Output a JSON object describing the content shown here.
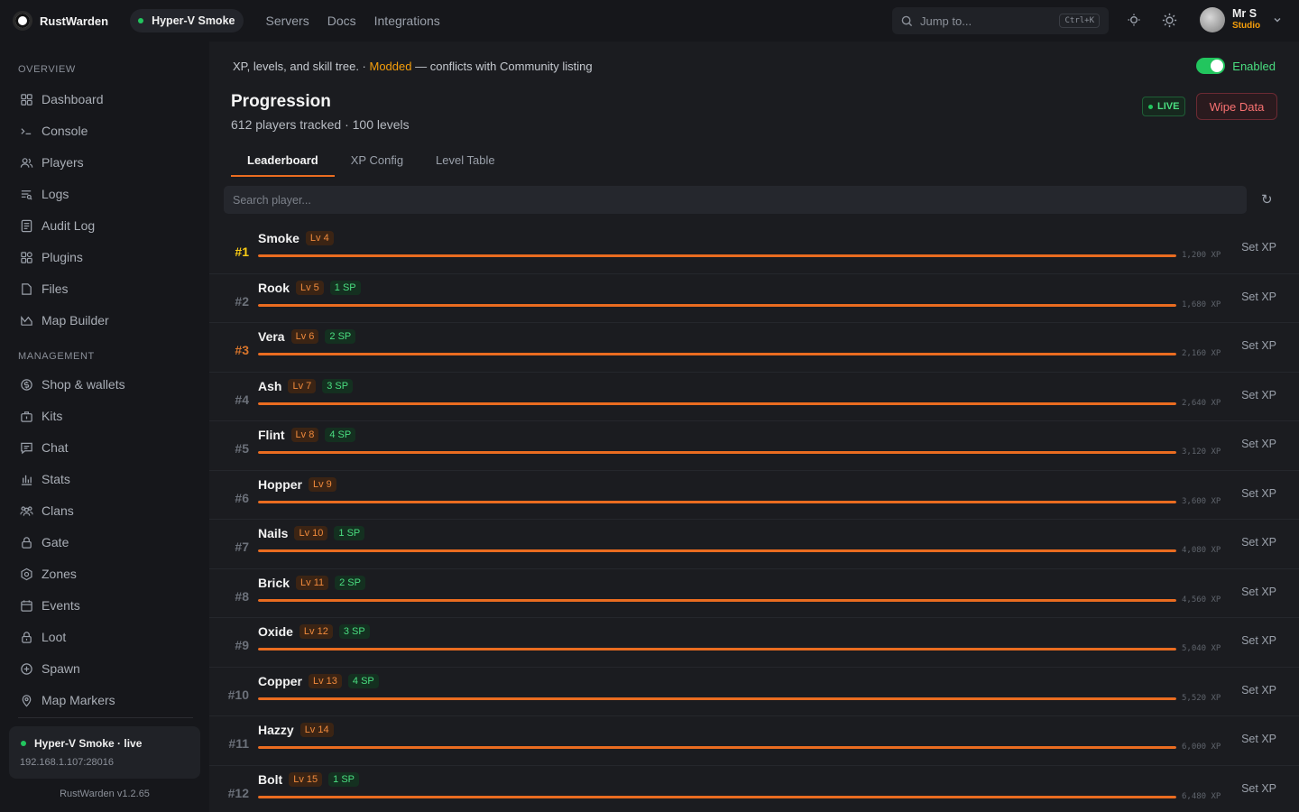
{
  "app": {
    "name": "RustWarden"
  },
  "header": {
    "server_pill": "Hyper-V Smoke",
    "nav": [
      "Servers",
      "Docs",
      "Integrations"
    ],
    "search_placeholder": "Jump to...",
    "search_shortcut": "Ctrl+K",
    "user": {
      "name": "Mr S",
      "role": "Studio"
    }
  },
  "sidebar": {
    "sections": [
      {
        "title": "OVERVIEW",
        "items": [
          {
            "label": "Dashboard",
            "icon": "grid-icon"
          },
          {
            "label": "Console",
            "icon": "terminal-icon"
          },
          {
            "label": "Players",
            "icon": "users-icon"
          },
          {
            "label": "Logs",
            "icon": "logs-icon"
          },
          {
            "label": "Audit Log",
            "icon": "audit-icon"
          },
          {
            "label": "Plugins",
            "icon": "plugins-icon"
          },
          {
            "label": "Files",
            "icon": "file-icon"
          },
          {
            "label": "Map Builder",
            "icon": "map-icon"
          }
        ]
      },
      {
        "title": "MANAGEMENT",
        "items": [
          {
            "label": "Shop & wallets",
            "icon": "coin-icon"
          },
          {
            "label": "Kits",
            "icon": "briefcase-icon"
          },
          {
            "label": "Chat",
            "icon": "chat-icon"
          },
          {
            "label": "Stats",
            "icon": "bar-chart-icon"
          },
          {
            "label": "Clans",
            "icon": "clans-icon"
          },
          {
            "label": "Gate",
            "icon": "lock-icon"
          },
          {
            "label": "Zones",
            "icon": "hexagon-icon"
          },
          {
            "label": "Events",
            "icon": "calendar-icon"
          },
          {
            "label": "Loot",
            "icon": "loot-icon"
          },
          {
            "label": "Spawn",
            "icon": "plus-circle-icon"
          },
          {
            "label": "Map Markers",
            "icon": "pin-icon"
          }
        ]
      }
    ],
    "server_card": {
      "name": "Hyper-V Smoke · live",
      "address": "192.168.1.107:28016"
    },
    "version": "RustWarden v1.2.65"
  },
  "plugin": {
    "description": "XP, levels, and skill tree. · ",
    "modded": "Modded",
    "conflict": " — conflicts with Community listing",
    "toggle_label": "Enabled",
    "toggle_on": true,
    "title": "Progression",
    "subtitle": "612 players tracked · 100 levels",
    "live_badge": "LIVE",
    "wipe_button": "Wipe Data",
    "tabs": [
      "Leaderboard",
      "XP Config",
      "Level Table"
    ],
    "active_tab": 0,
    "search_placeholder": "Search player...",
    "set_xp_label": "Set XP"
  },
  "leaderboard": [
    {
      "rank": "#1",
      "name": "Smoke",
      "level": "Lv 4",
      "sp": "",
      "xp": "1,200 XP",
      "progress": 1.0
    },
    {
      "rank": "#2",
      "name": "Rook",
      "level": "Lv 5",
      "sp": "1 SP",
      "xp": "1,680 XP",
      "progress": 1.0
    },
    {
      "rank": "#3",
      "name": "Vera",
      "level": "Lv 6",
      "sp": "2 SP",
      "xp": "2,160 XP",
      "progress": 1.0
    },
    {
      "rank": "#4",
      "name": "Ash",
      "level": "Lv 7",
      "sp": "3 SP",
      "xp": "2,640 XP",
      "progress": 1.0
    },
    {
      "rank": "#5",
      "name": "Flint",
      "level": "Lv 8",
      "sp": "4 SP",
      "xp": "3,120 XP",
      "progress": 1.0
    },
    {
      "rank": "#6",
      "name": "Hopper",
      "level": "Lv 9",
      "sp": "",
      "xp": "3,600 XP",
      "progress": 1.0
    },
    {
      "rank": "#7",
      "name": "Nails",
      "level": "Lv 10",
      "sp": "1 SP",
      "xp": "4,080 XP",
      "progress": 1.0
    },
    {
      "rank": "#8",
      "name": "Brick",
      "level": "Lv 11",
      "sp": "2 SP",
      "xp": "4,560 XP",
      "progress": 1.0
    },
    {
      "rank": "#9",
      "name": "Oxide",
      "level": "Lv 12",
      "sp": "3 SP",
      "xp": "5,040 XP",
      "progress": 1.0
    },
    {
      "rank": "#10",
      "name": "Copper",
      "level": "Lv 13",
      "sp": "4 SP",
      "xp": "5,520 XP",
      "progress": 1.0
    },
    {
      "rank": "#11",
      "name": "Hazzy",
      "level": "Lv 14",
      "sp": "",
      "xp": "6,000 XP",
      "progress": 1.0
    },
    {
      "rank": "#12",
      "name": "Bolt",
      "level": "Lv 15",
      "sp": "1 SP",
      "xp": "6,480 XP",
      "progress": 1.0
    }
  ],
  "colors": {
    "accent": "#ea6c20",
    "live_green": "#22c55e",
    "modded_amber": "#f59e0b",
    "rank_gold": "#facc15",
    "rank_bronze": "#d9752b",
    "danger": "#f87171"
  }
}
